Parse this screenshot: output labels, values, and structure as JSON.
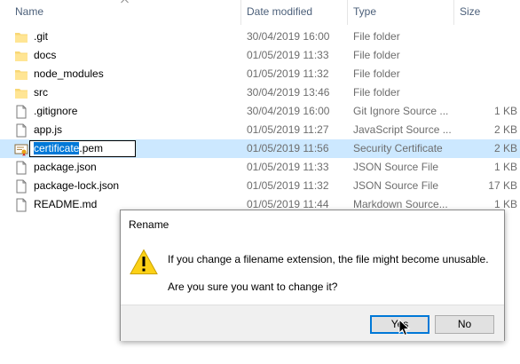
{
  "columns": {
    "name": "Name",
    "date": "Date modified",
    "type": "Type",
    "size": "Size"
  },
  "files": [
    {
      "name": ".git",
      "date": "30/04/2019 16:00",
      "type": "File folder",
      "size": "",
      "icon": "folder-icon"
    },
    {
      "name": "docs",
      "date": "01/05/2019 11:33",
      "type": "File folder",
      "size": "",
      "icon": "folder-icon"
    },
    {
      "name": "node_modules",
      "date": "01/05/2019 11:32",
      "type": "File folder",
      "size": "",
      "icon": "folder-icon"
    },
    {
      "name": "src",
      "date": "30/04/2019 13:46",
      "type": "File folder",
      "size": "",
      "icon": "folder-icon"
    },
    {
      "name": ".gitignore",
      "date": "30/04/2019 16:00",
      "type": "Git Ignore Source ...",
      "size": "1 KB",
      "icon": "file-icon"
    },
    {
      "name": "app.js",
      "date": "01/05/2019 11:27",
      "type": "JavaScript Source ...",
      "size": "2 KB",
      "icon": "file-icon"
    },
    {
      "name": "certificate.pem",
      "date": "01/05/2019 11:56",
      "type": "Security Certificate",
      "size": "2 KB",
      "icon": "certificate-icon"
    },
    {
      "name": "package.json",
      "date": "01/05/2019 11:33",
      "type": "JSON Source File",
      "size": "1 KB",
      "icon": "file-icon"
    },
    {
      "name": "package-lock.json",
      "date": "01/05/2019 11:32",
      "type": "JSON Source File",
      "size": "17 KB",
      "icon": "file-icon"
    },
    {
      "name": "README.md",
      "date": "01/05/2019 11:44",
      "type": "Markdown Source...",
      "size": "1 KB",
      "icon": "file-icon"
    }
  ],
  "rename": {
    "base": "certificate",
    "ext": ".pem"
  },
  "dialog": {
    "title": "Rename",
    "message": "If you change a filename extension, the file might become unusable.",
    "question": "Are you sure you want to change it?",
    "yes_label": "Yes",
    "no_label": "No"
  }
}
